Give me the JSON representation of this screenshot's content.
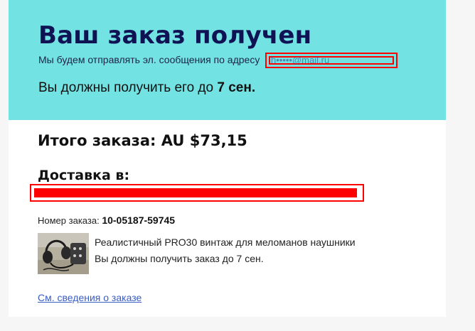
{
  "header": {
    "title": "Ваш заказ получен",
    "email_prefix": "Мы будем отправлять эл. сообщения по адресу",
    "email_redacted": "h•••••@mail.ru",
    "deliver_prefix": "Вы должны получить его до",
    "deliver_date": "7 сен."
  },
  "summary": {
    "total_label": "Итого заказа:",
    "total_value": "AU $73,15",
    "shipping_label": "Доставка в:"
  },
  "order": {
    "number_label": "Номер заказа:",
    "number_value": "10-05187-59745",
    "item_title": "Реалистичный PRO30 винтаж для меломанов наушники",
    "item_eta": "Вы должны получить заказ до 7 сен.",
    "item_image_icon": "headphones-photo"
  },
  "links": {
    "details": "См. сведения о заказе"
  },
  "colors": {
    "hero_bg": "#72e2e3",
    "title": "#0f1353",
    "redaction": "#ff0000",
    "link": "#3a5dc2"
  }
}
